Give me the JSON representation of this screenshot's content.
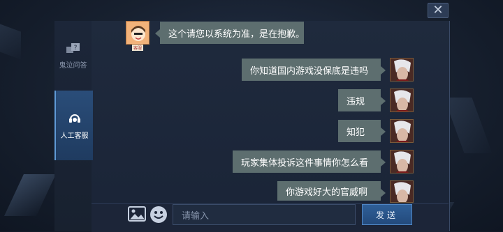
{
  "window": {
    "close_icon": "close-icon"
  },
  "sidebar": {
    "items": [
      {
        "label": "鬼泣问答",
        "icon": "question-chat-icon",
        "active": false
      },
      {
        "label": "人工客服",
        "icon": "headset-icon",
        "active": true
      }
    ]
  },
  "chat": {
    "messages": [
      {
        "side": "left",
        "text": "这个请您以系统为准，是在抱歉。",
        "avatar": "customer-service-avatar"
      },
      {
        "side": "right",
        "text": "你知道国内游戏没保底是违吗",
        "avatar": "player-avatar"
      },
      {
        "side": "right",
        "text": "违规",
        "avatar": "player-avatar"
      },
      {
        "side": "right",
        "text": "知犯",
        "avatar": "player-avatar"
      },
      {
        "side": "right",
        "text": "玩家集体投诉这件事情你怎么看",
        "avatar": "player-avatar"
      },
      {
        "side": "right",
        "text": "你游戏好大的官威啊",
        "avatar": "player-avatar"
      }
    ]
  },
  "input_bar": {
    "image_icon": "image-icon",
    "emoji_icon": "emoji-icon",
    "placeholder": "请输入",
    "send_label": "发送"
  },
  "colors": {
    "bubble": "#5d6e6f",
    "accent": "#2f5f98"
  }
}
